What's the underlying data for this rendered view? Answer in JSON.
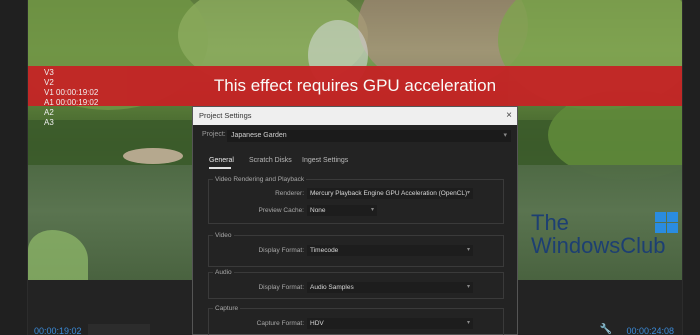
{
  "video": {
    "banner_text": "This effect requires GPU acceleration",
    "tracks": [
      "V3",
      "V2",
      "V1 00:00:19:02",
      "A1 00:00:19:02",
      "A2",
      "A3"
    ]
  },
  "timecode": {
    "left": "00:00:19:02",
    "right": "00:00:24:08"
  },
  "watermark": {
    "line1": "The",
    "line2": "WindowsClub"
  },
  "dialog": {
    "title": "Project Settings",
    "close_glyph": "×",
    "project_label": "Project:",
    "project_value": "Japanese Garden",
    "tabs": [
      "General",
      "Scratch Disks",
      "Ingest Settings"
    ],
    "sections": {
      "rendering": {
        "title": "Video Rendering and Playback",
        "renderer_label": "Renderer:",
        "renderer_value": "Mercury Playback Engine GPU Acceleration (OpenCL)",
        "preview_cache_label": "Preview Cache:",
        "preview_cache_value": "None"
      },
      "video": {
        "title": "Video",
        "display_format_label": "Display Format:",
        "display_format_value": "Timecode"
      },
      "audio": {
        "title": "Audio",
        "display_format_label": "Display Format:",
        "display_format_value": "Audio Samples"
      },
      "capture": {
        "title": "Capture",
        "capture_format_label": "Capture Format:",
        "capture_format_value": "HDV"
      }
    }
  },
  "colors": {
    "banner": "#c42425",
    "timecode": "#3b8bd9",
    "logo": "#1d3f72"
  },
  "icons": [
    "wrench-icon",
    "windows-logo-icon",
    "chevron-down-icon",
    "close-icon"
  ]
}
